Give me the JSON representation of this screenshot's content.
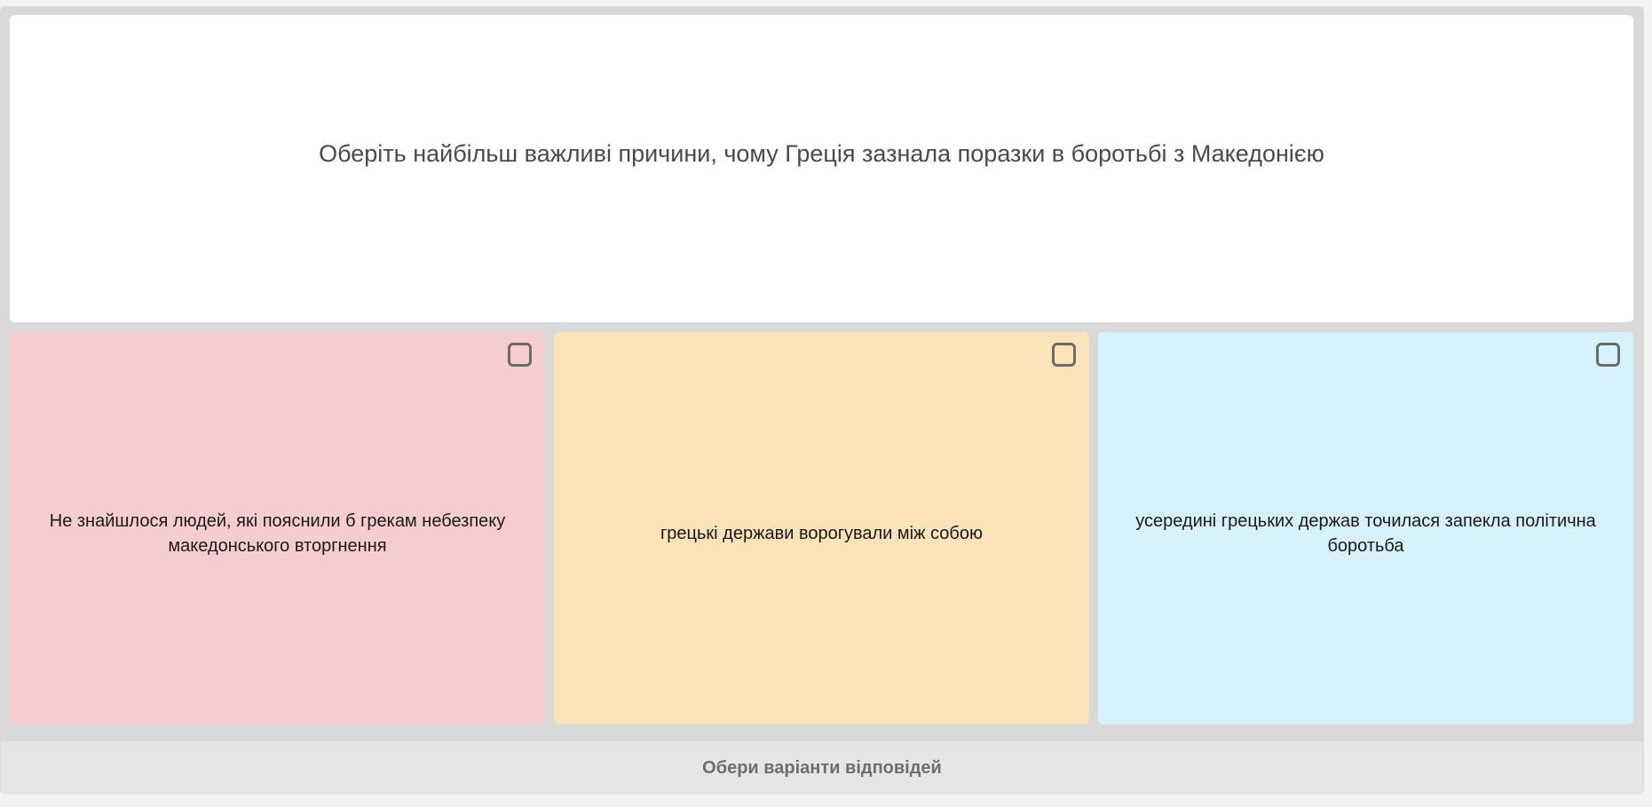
{
  "question": {
    "text": "Оберіть найбільш важливі причини, чому Греція зазнала поразки в боротьбі з Македонією"
  },
  "options": [
    {
      "text": "Не знайшлося людей, які пояснили б грекам небезпеку македонського вторгнення",
      "color": "#f6cdce",
      "checked": false
    },
    {
      "text": "грецькі держави ворогували між собою",
      "color": "#fbe2b9",
      "checked": false
    },
    {
      "text": "усередині грецьких держав точилася запекла політична боротьба",
      "color": "#d7f1fa",
      "checked": false
    }
  ],
  "footer": {
    "instruction": "Обери варіанти відповідей"
  }
}
